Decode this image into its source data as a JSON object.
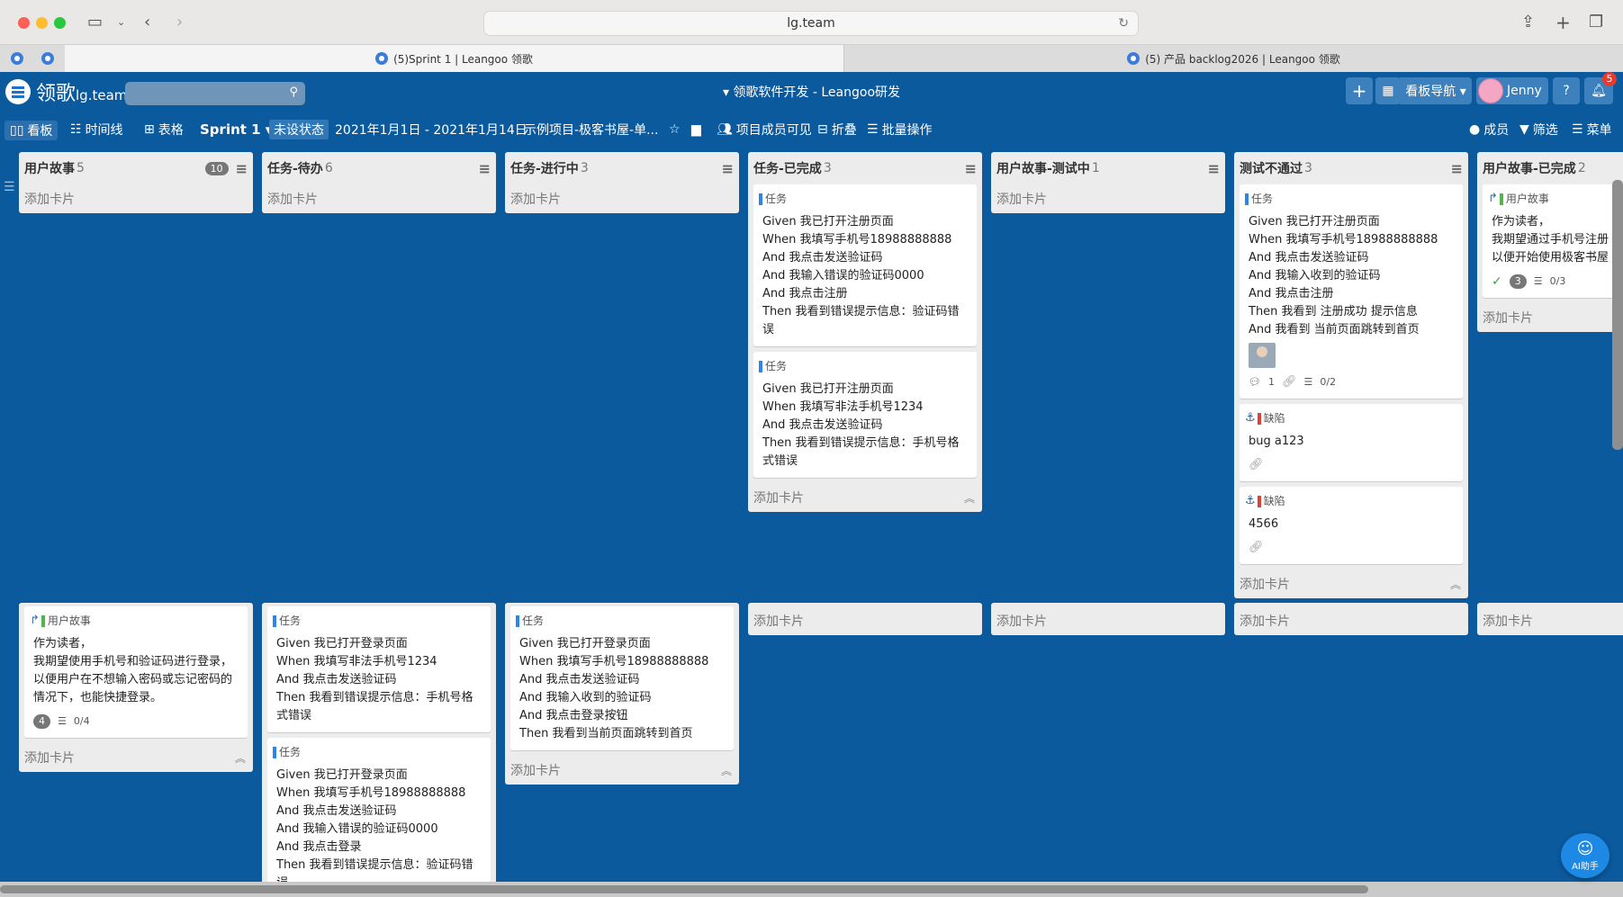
{
  "browser": {
    "url": "lg.team",
    "tab_active": "(5)Sprint 1 | Leangoo 领歌",
    "tab_inactive": "(5) 产品 backlog2026 | Leangoo 领歌"
  },
  "header": {
    "logo_cn": "领歌",
    "logo_en": "lg.team",
    "board_title": "▾ 领歌软件开发 - Leangoo研发",
    "plus": "+",
    "board_nav": "看板导航 ▾",
    "user": "Jenny",
    "help": "?",
    "notify_count": "5"
  },
  "toolbar": {
    "board": "看板",
    "timeline": "时间线",
    "table": "表格",
    "sprint": "Sprint 1 ▾",
    "status": "未设状态",
    "dates": "2021年1月1日 - 2021年1月14日",
    "project": "示例项目-极客书屋-单...",
    "visible": "项目成员可见",
    "fold": "折叠",
    "batch": "批量操作",
    "members": "成员",
    "filter": "筛选",
    "menu": "菜单"
  },
  "lists": [
    {
      "title": "用户故事",
      "count": "5",
      "badge": "10",
      "add": "添加卡片"
    },
    {
      "title": "任务-待办",
      "count": "6",
      "add": "添加卡片"
    },
    {
      "title": "任务-进行中",
      "count": "3",
      "add": "添加卡片"
    },
    {
      "title": "任务-已完成",
      "count": "3",
      "add": "添加卡片",
      "cards": [
        {
          "type": "任务",
          "lines": [
            "Given 我已打开注册页面",
            "When 我填写手机号18988888888",
            "And 我点击发送验证码",
            "And 我输入错误的验证码0000",
            "And 我点击注册",
            "Then 我看到错误提示信息：验证码错误"
          ]
        },
        {
          "type": "任务",
          "lines": [
            "Given 我已打开注册页面",
            "When 我填写非法手机号1234",
            "And 我点击发送验证码",
            "Then 我看到错误提示信息：手机号格式错误"
          ]
        }
      ]
    },
    {
      "title": "用户故事-测试中",
      "count": "1",
      "add": "添加卡片"
    },
    {
      "title": "测试不通过",
      "count": "3",
      "add": "添加卡片",
      "cards": [
        {
          "type": "任务",
          "lines": [
            "Given 我已打开注册页面",
            "When 我填写手机号18988888888",
            "And 我点击发送验证码",
            "And 我输入收到的验证码",
            "And 我点击注册",
            "Then 我看到 注册成功 提示信息",
            "And 我看到 当前页面跳转到首页"
          ],
          "comments": "1",
          "checklist": "0/2"
        },
        {
          "type": "缺陷",
          "lines": [
            "bug a123"
          ]
        },
        {
          "type": "缺陷",
          "lines": [
            "4566"
          ]
        }
      ]
    },
    {
      "title": "用户故事-已完成",
      "count": "2",
      "add": "添加卡片",
      "cards": [
        {
          "type": "用户故事",
          "lines": [
            "作为读者，",
            "我期望通过手机号注册",
            "以便开始使用极客书屋"
          ],
          "badge": "3",
          "checklist": "0/3"
        }
      ]
    }
  ],
  "lists2": [
    {
      "add": "添加卡片",
      "cards": [
        {
          "type": "用户故事",
          "lines": [
            "作为读者，",
            "我期望使用手机号和验证码进行登录，",
            "以便用户在不想输入密码或忘记密码的情况下，也能快捷登录。"
          ],
          "badge": "4",
          "checklist": "0/4"
        }
      ]
    },
    {
      "add": "添加卡片",
      "cards": [
        {
          "type": "任务",
          "lines": [
            "Given 我已打开登录页面",
            "When 我填写非法手机号1234",
            "And 我点击发送验证码",
            "Then 我看到错误提示信息：手机号格式错误"
          ]
        },
        {
          "type": "任务",
          "lines": [
            "Given 我已打开登录页面",
            "When 我填写手机号18988888888",
            "And 我点击发送验证码",
            "And 我输入错误的验证码0000",
            "And 我点击登录",
            "Then 我看到错误提示信息：验证码错误"
          ]
        }
      ]
    },
    {
      "add": "添加卡片",
      "cards": [
        {
          "type": "任务",
          "lines": [
            "Given 我已打开登录页面",
            "When 我填写手机号18988888888",
            "And 我点击发送验证码",
            "And 我输入收到的验证码",
            "And 我点击登录按钮",
            "Then 我看到当前页面跳转到首页"
          ]
        }
      ]
    },
    {
      "add": "添加卡片"
    },
    {
      "add": "添加卡片"
    },
    {
      "add": "添加卡片"
    },
    {
      "add": "添加卡片"
    }
  ],
  "ai": "AI助手",
  "colors": {
    "board_bg": "#0b5a9e",
    "task": "#2b87e3",
    "story": "#52b44a",
    "bug": "#e0403a"
  }
}
